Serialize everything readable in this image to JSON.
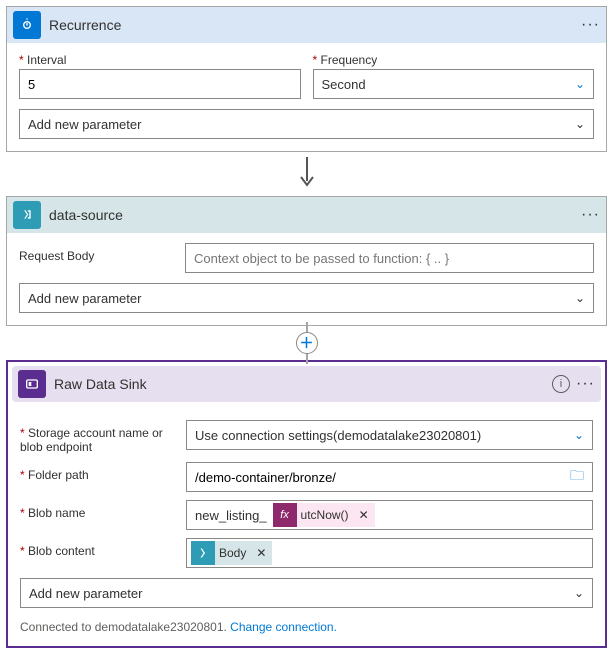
{
  "cards": {
    "recurrence": {
      "title": "Recurrence",
      "interval_label": "Interval",
      "interval_value": "5",
      "frequency_label": "Frequency",
      "frequency_value": "Second",
      "add_param": "Add new parameter"
    },
    "datasource": {
      "title": "data-source",
      "request_body_label": "Request Body",
      "request_body_placeholder": "Context object to be passed to function: { .. }",
      "add_param": "Add new parameter"
    },
    "rawsink": {
      "title": "Raw Data Sink",
      "storage_label": "Storage account name or blob endpoint",
      "storage_value": "Use connection settings(demodatalake23020801)",
      "folder_label": "Folder path",
      "folder_value": "/demo-container/bronze/",
      "blobname_label": "Blob name",
      "blobname_prefix": "new_listing_",
      "blobname_token": "utcNow()",
      "blobcontent_label": "Blob content",
      "blobcontent_token": "Body",
      "add_param": "Add new parameter",
      "connected_prefix": "Connected to demodatalake23020801.  ",
      "change_link": "Change connection."
    }
  },
  "fx_badge_label": "fx"
}
